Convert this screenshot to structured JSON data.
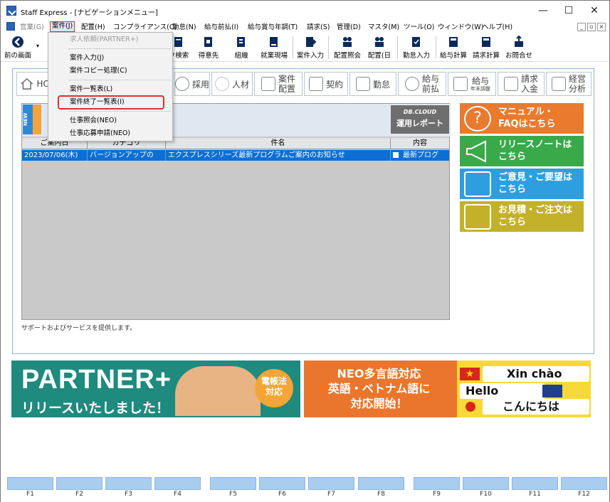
{
  "window": {
    "title": "Staff Express - [ナビゲーションメニュー]",
    "controls": {
      "minimize": "—",
      "maximize": "☐",
      "close": "✕"
    }
  },
  "menubar": {
    "items": [
      {
        "label": "営業(G)",
        "state": "disabled"
      },
      {
        "label": "案件(J)",
        "state": "active"
      },
      {
        "label": "配置(H)",
        "state": "normal"
      },
      {
        "label": "コンプライアンス(C)",
        "state": "normal"
      },
      {
        "label": "勤怠(N)",
        "state": "normal"
      },
      {
        "label": "給与前払(I)",
        "state": "normal"
      },
      {
        "label": "給与賞与年調(T)",
        "state": "normal"
      },
      {
        "label": "請求(S)",
        "state": "normal"
      },
      {
        "label": "管理(D)",
        "state": "normal"
      },
      {
        "label": "マスタ(M)",
        "state": "normal"
      },
      {
        "label": "ツール(O)",
        "state": "normal"
      },
      {
        "label": "ウィンドウ(W)",
        "state": "normal"
      },
      {
        "label": "ヘルプ(H)",
        "state": "normal"
      }
    ],
    "mdi": {
      "minimize": "_",
      "restore": "▫",
      "close": "×"
    }
  },
  "toolbar": {
    "items": [
      {
        "label": "前の画面",
        "icon": "back-arrow-icon"
      },
      {
        "label": "ク検索",
        "icon": "search-doc-icon"
      },
      {
        "label": "得意先",
        "icon": "customer-icon"
      },
      {
        "label": "組織",
        "icon": "organization-icon"
      },
      {
        "label": "就業現場",
        "icon": "workplace-icon"
      },
      {
        "label": "案件入力",
        "icon": "case-input-icon"
      },
      {
        "label": "配置照会",
        "icon": "placement-inquiry-icon"
      },
      {
        "label": "配置(日",
        "icon": "placement-day-icon"
      },
      {
        "label": "勤怠入力",
        "icon": "attendance-input-icon"
      },
      {
        "label": "給与計算",
        "icon": "payroll-calc-icon"
      },
      {
        "label": "請求計算",
        "icon": "billing-calc-icon"
      },
      {
        "label": "お問合せ",
        "icon": "inquiry-icon"
      }
    ]
  },
  "nav_tabs": [
    {
      "label": "HO",
      "icon": "home-icon"
    },
    {
      "label": "採用",
      "icon": "recruit-icon"
    },
    {
      "label": "人材",
      "icon": "staff-icon"
    },
    {
      "label": "案件",
      "sublabel": "配置",
      "icon": "case-icon"
    },
    {
      "label": "契約",
      "icon": "contract-icon"
    },
    {
      "label": "勤怠",
      "icon": "attendance-icon"
    },
    {
      "label": "給与",
      "sublabel": "前払",
      "icon": "prepay-icon"
    },
    {
      "label": "給与",
      "sublabel": "年末調整",
      "icon": "year-end-icon"
    },
    {
      "label": "請求",
      "sublabel": "入金",
      "icon": "billing-icon"
    },
    {
      "label": "経営",
      "sublabel": "分析",
      "icon": "analysis-icon"
    }
  ],
  "info": {
    "new_tag": "NEW",
    "dbcloud": {
      "line1": "DB.CLOUD",
      "line2": "運用レポート"
    },
    "columns": [
      "ご案内日",
      "カテゴリ",
      "件名",
      "内容"
    ],
    "rows": [
      {
        "date": "2023/07/06(木)",
        "category": "バージョンアップの",
        "subject": "エクスプレスシリーズ最新プログラムご案内のお知らせ",
        "content": "最新プログ"
      }
    ],
    "support_text": "サポートおよびサービスを提供します。"
  },
  "side_buttons": [
    {
      "line1": "マニュアル・",
      "line2": "FAQはこちら",
      "color": "#ea7a2d",
      "icon": "question-icon"
    },
    {
      "line1": "リリースノートは",
      "line2": "こちら",
      "color": "#3aa94a",
      "icon": "megaphone-icon"
    },
    {
      "line1": "ご意見・ご要望は",
      "line2": "こちら",
      "color": "#2d9fe0",
      "icon": "feedback-box-icon"
    },
    {
      "line1": "お見積・ご注文は",
      "line2": "こちら",
      "color": "#c3b12a",
      "icon": "estimate-icon"
    }
  ],
  "banners": {
    "partner": {
      "title": "PARTNER+",
      "subtitle": "リリースいたしました！",
      "badge": "電帳法\n対応"
    },
    "neo": {
      "title": "NEO多言語対応\n英語・ベトナム語に\n対応開始！",
      "greeting_vi": "Xin chào",
      "greeting_en": "Hello",
      "greeting_ja": "こんにちは"
    }
  },
  "fkeys": [
    "F1",
    "F2",
    "F3",
    "F4",
    "F5",
    "F6",
    "F7",
    "F8",
    "F9",
    "F10",
    "F11",
    "F12"
  ],
  "dropdown": {
    "items": [
      {
        "label": "求人依頼(PARTNER+)",
        "state": "disabled"
      },
      {
        "label": "案件入力(J)",
        "state": "normal"
      },
      {
        "label": "案件コピー処理(C)",
        "state": "normal"
      },
      {
        "label": "案件一覧表(L)",
        "state": "normal"
      },
      {
        "label": "案件終了一覧表(I)",
        "state": "highlighted"
      },
      {
        "label": "仕事照会(NEO)",
        "state": "normal"
      },
      {
        "label": "仕事応募申請(NEO)",
        "state": "normal"
      }
    ]
  }
}
